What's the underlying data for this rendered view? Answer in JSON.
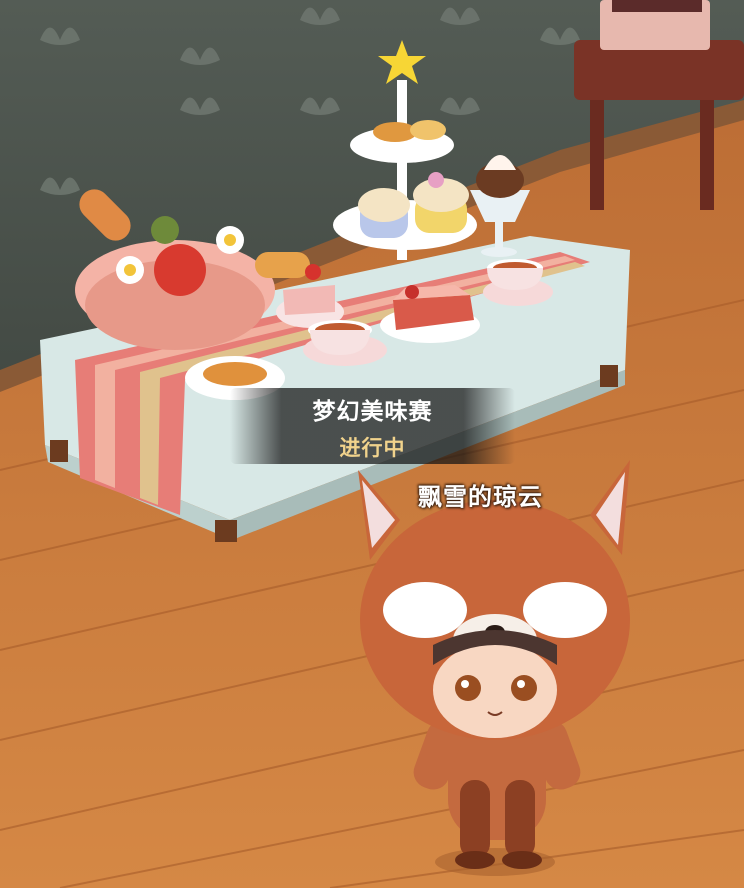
{
  "event": {
    "title": "梦幻美味赛",
    "status": "进行中"
  },
  "player": {
    "name": "飘雪的琼云"
  },
  "colors": {
    "wall": "#4b534c",
    "floor": "#c9783a",
    "status_text": "#f1d38c",
    "label_text": "#ffffff"
  }
}
